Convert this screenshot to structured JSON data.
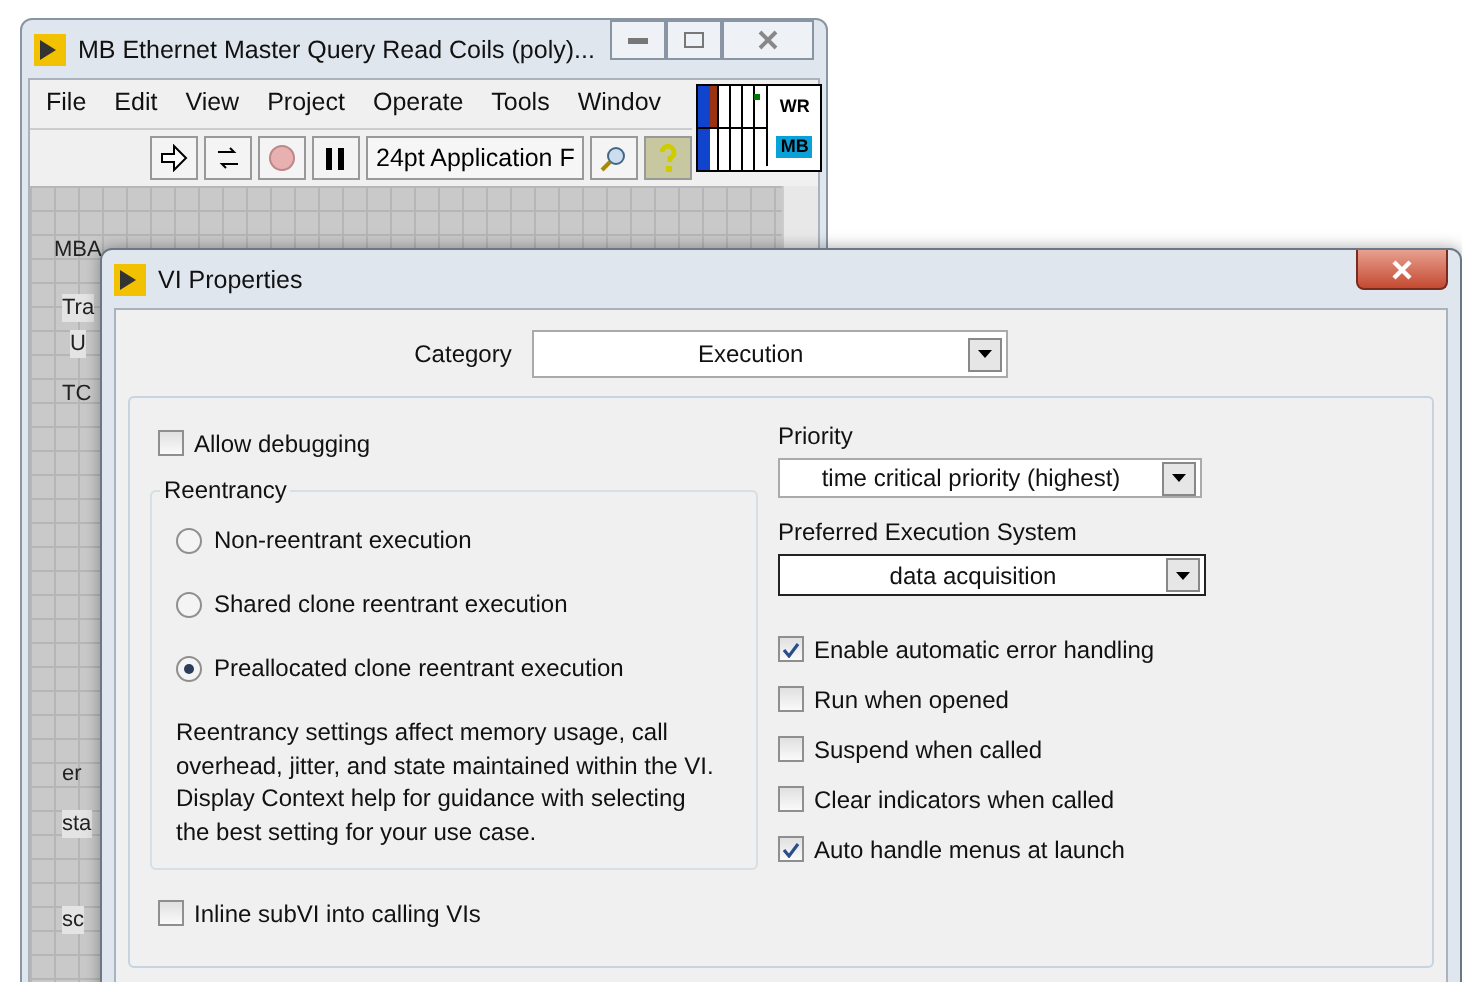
{
  "back_window": {
    "title": "MB Ethernet Master Query Read Coils (poly)...",
    "menu": [
      "File",
      "Edit",
      "View",
      "Project",
      "Operate",
      "Tools",
      "Windov"
    ],
    "font_selector": "24pt Application F",
    "help_on": true,
    "icon_texts": [
      "WR",
      "MB"
    ],
    "panel_fragments": [
      {
        "text": "MBA",
        "kind": "label"
      },
      {
        "text": "Tra",
        "kind": "boxed"
      },
      {
        "text": "U",
        "kind": "boxed"
      },
      {
        "text": "TC",
        "kind": "label"
      },
      {
        "text": "er",
        "kind": "label"
      },
      {
        "text": "sta",
        "kind": "boxed"
      },
      {
        "text": "sc",
        "kind": "boxed"
      }
    ]
  },
  "dialog": {
    "title": "VI Properties",
    "category_label": "Category",
    "category_value": "Execution",
    "allow_debugging": {
      "label": "Allow debugging",
      "checked": false
    },
    "reentrancy": {
      "title": "Reentrancy",
      "options": [
        {
          "label": "Non-reentrant execution",
          "selected": false
        },
        {
          "label": "Shared clone reentrant execution",
          "selected": false
        },
        {
          "label": "Preallocated clone reentrant execution",
          "selected": true
        }
      ],
      "note": "Reentrancy settings affect memory usage, call overhead, jitter, and state maintained within the VI. Display Context help for guidance with selecting the best setting for your use case."
    },
    "inline_subvi": {
      "label": "Inline subVI into calling VIs",
      "checked": false
    },
    "priority_label": "Priority",
    "priority_value": "time critical priority (highest)",
    "system_label": "Preferred Execution System",
    "system_value": "data acquisition",
    "options": [
      {
        "label": "Enable automatic error handling",
        "checked": true
      },
      {
        "label": "Run when opened",
        "checked": false
      },
      {
        "label": "Suspend when called",
        "checked": false
      },
      {
        "label": "Clear indicators when called",
        "checked": false
      },
      {
        "label": "Auto handle menus at launch",
        "checked": true
      }
    ]
  }
}
